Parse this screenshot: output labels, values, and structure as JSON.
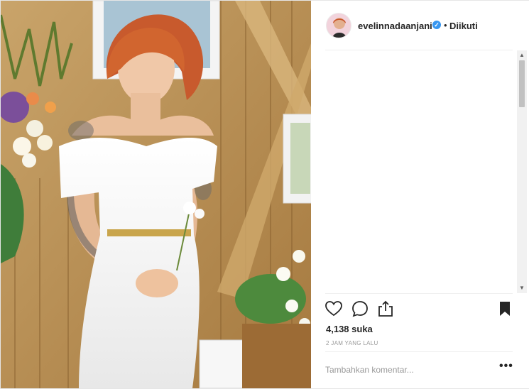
{
  "post": {
    "photo_alt": "evelinnadaanjani post photo",
    "header": {
      "username": "evelinnadaanjani",
      "verified_icon": "verified-badge-icon",
      "separator": "•",
      "follow_status": "Diikuti"
    },
    "actions": {
      "like_icon": "heart-outline-icon",
      "comment_icon": "speech-bubble-icon",
      "share_icon": "share-upload-icon",
      "save_icon": "bookmark-filled-icon"
    },
    "likes_text": "4,138 suka",
    "timestamp": "2 JAM YANG LALU",
    "add_comment_placeholder": "Tambahkan komentar...",
    "more_label": "•••"
  },
  "colors": {
    "text": "#262626",
    "muted": "#999999",
    "divider": "#efefef",
    "verified": "#3897f0"
  }
}
